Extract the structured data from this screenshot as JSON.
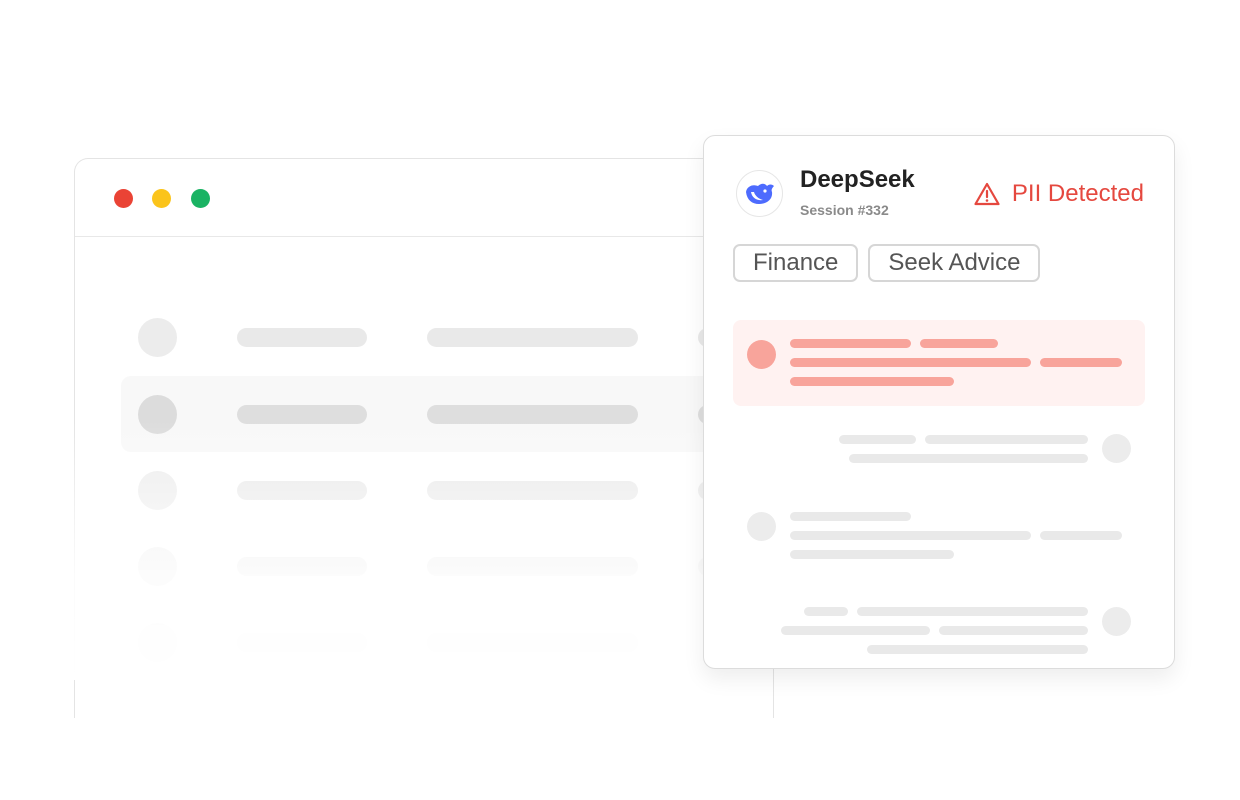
{
  "window": {
    "traffic_lights": {
      "close": "#ea4335",
      "minimize": "#fbc41b",
      "zoom": "#1ab363"
    }
  },
  "session_card": {
    "app_name": "DeepSeek",
    "app_logo_icon": "deepseek-whale-icon",
    "session_label": "Session #332",
    "alert": {
      "icon": "warning-triangle-icon",
      "text": "PII Detected",
      "color": "#e5483f"
    },
    "tags": [
      {
        "label": "Finance"
      },
      {
        "label": "Seek Advice"
      }
    ],
    "flag_highlight_color": "#f8a49b",
    "flag_background_color": "#fff2f1"
  }
}
